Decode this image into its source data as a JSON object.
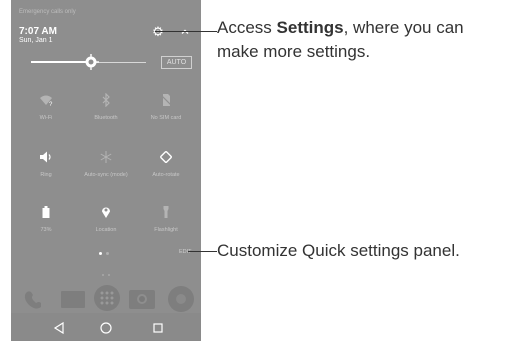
{
  "phone": {
    "status_text": "Emergency calls only",
    "time": "7:07 AM",
    "date": "Sun, Jan 1",
    "brightness": 0.52,
    "auto_label": "AUTO",
    "tiles": [
      {
        "label": "Wi-Fi",
        "icon": "wifi-icon",
        "active": false
      },
      {
        "label": "Bluetooth",
        "icon": "bluetooth-icon",
        "active": false
      },
      {
        "label": "No SIM card",
        "icon": "sim-card-icon",
        "active": false
      },
      {
        "label": "Ring",
        "icon": "volume-icon",
        "active": true
      },
      {
        "label": "Auto-sync (mode)",
        "icon": "sync-icon",
        "active": false
      },
      {
        "label": "Auto-rotate",
        "icon": "rotate-icon",
        "active": true
      },
      {
        "label": "73%",
        "icon": "battery-icon",
        "active": true
      },
      {
        "label": "Location",
        "icon": "location-icon",
        "active": true
      },
      {
        "label": "Flashlight",
        "icon": "flashlight-icon",
        "active": false
      }
    ],
    "edit_label": "EDIT",
    "page_dots": 2,
    "current_page": 1,
    "nav": [
      "back-icon",
      "home-icon",
      "recents-icon"
    ]
  },
  "callouts": {
    "settings_prefix": "Access ",
    "settings_bold": "Settings",
    "settings_suffix": ", where you can",
    "settings_line2": "make more settings.",
    "customize": "Customize Quick settings panel."
  },
  "colors": {
    "panel": "#8e8e8e",
    "active": "#ffffff",
    "inactive": "#b4b4b4",
    "callout_text": "#333333"
  }
}
